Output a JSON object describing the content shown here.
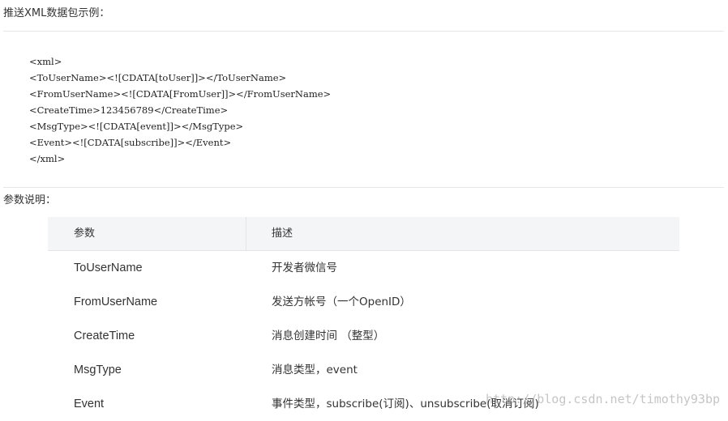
{
  "headings": {
    "push_example": "推送XML数据包示例：",
    "param_desc": "参数说明："
  },
  "code_lines": [
    "<xml>",
    "<ToUserName><![CDATA[toUser]]></ToUserName>",
    "<FromUserName><![CDATA[FromUser]]></FromUserName>",
    "<CreateTime>123456789</CreateTime>",
    "<MsgType><![CDATA[event]]></MsgType>",
    "<Event><![CDATA[subscribe]]></Event>",
    "</xml>"
  ],
  "table": {
    "headers": [
      "参数",
      "描述"
    ],
    "rows": [
      {
        "name": "ToUserName",
        "desc": "开发者微信号"
      },
      {
        "name": "FromUserName",
        "desc": "发送方帐号（一个OpenID）"
      },
      {
        "name": "CreateTime",
        "desc": "消息创建时间 （整型）"
      },
      {
        "name": "MsgType",
        "desc": "消息类型，event"
      },
      {
        "name": "Event",
        "desc": "事件类型，subscribe(订阅)、unsubscribe(取消订阅)"
      }
    ]
  },
  "watermark": "http://blog.csdn.net/timothy93bp",
  "colors": {
    "header_bg": "#f4f5f7",
    "divider": "#e6e6e6",
    "text": "#333333"
  }
}
